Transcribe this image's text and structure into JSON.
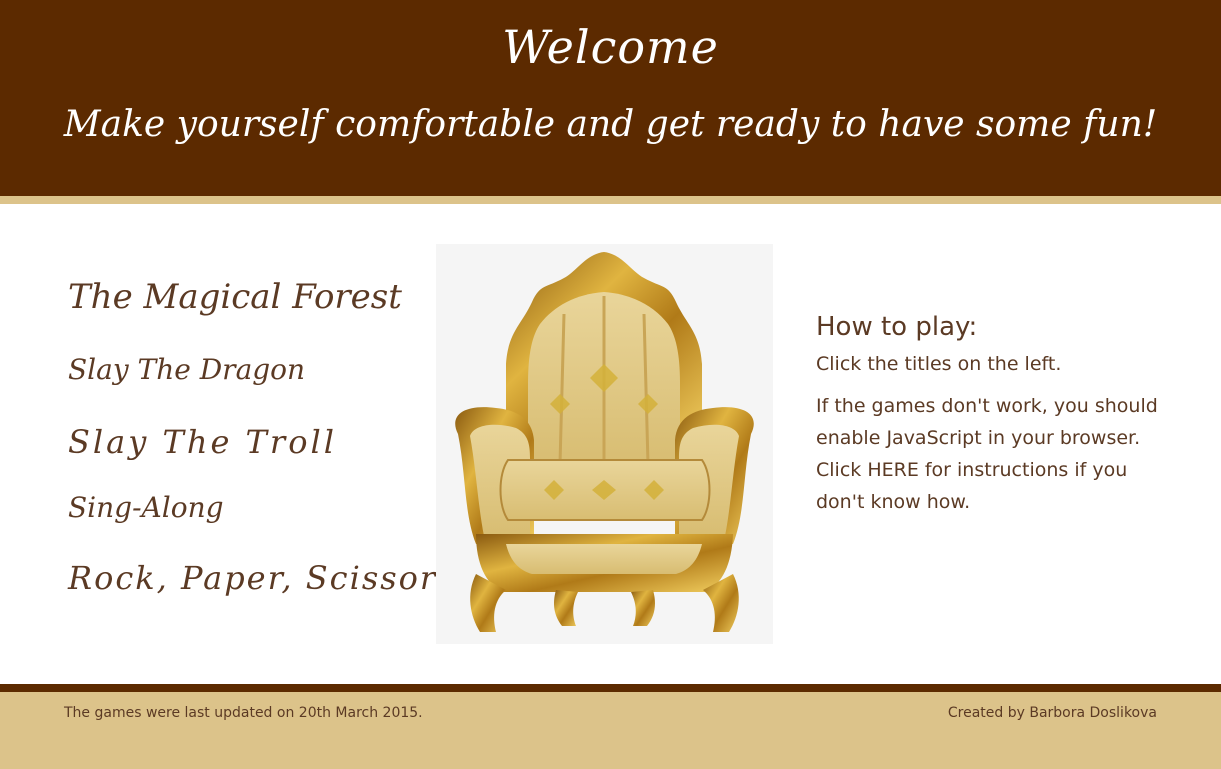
{
  "header": {
    "title": "Welcome",
    "tagline": "Make yourself comfortable and get ready to have some fun!"
  },
  "games": [
    {
      "label": "The Magical Forest"
    },
    {
      "label": "Slay The Dragon"
    },
    {
      "label": "Slay The Troll"
    },
    {
      "label": "Sing-Along"
    },
    {
      "label": "Rock, Paper, Scissors"
    }
  ],
  "howto": {
    "heading": "How to play:",
    "line1": "Click the titles on the left.",
    "line2_before": "If the games don't work, you should enable JavaScript in your browser. Click ",
    "here_link": "HERE",
    "line2_after": " for instructions if you don't know how."
  },
  "footer": {
    "updated": "The games were last updated on 20th March 2015.",
    "credit": "Created by Barbora Doslikova"
  },
  "colors": {
    "header_bg": "#5c2a00",
    "accent_gold": "#dcc38a",
    "text_brown": "#5b3a24"
  },
  "images": {
    "chair": "gold-throne-armchair"
  }
}
